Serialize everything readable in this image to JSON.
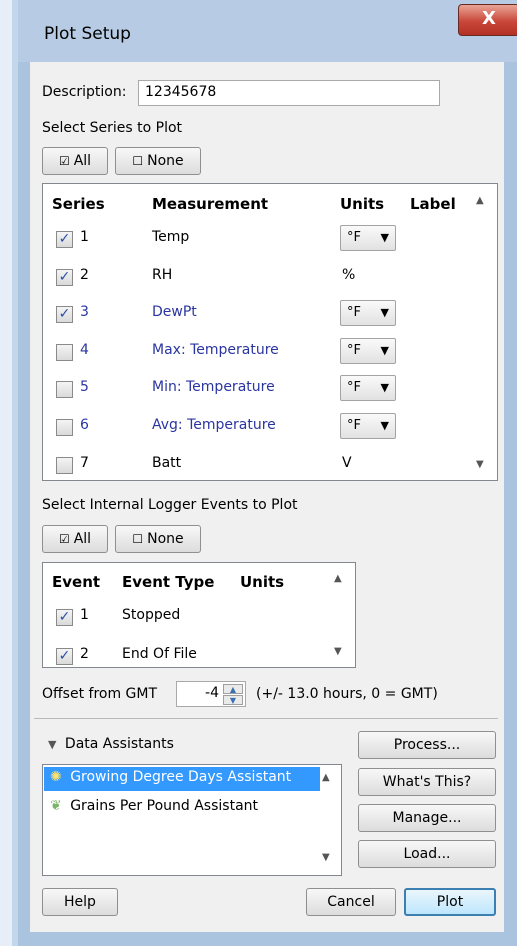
{
  "window": {
    "title": "Plot Setup",
    "close_label": "X"
  },
  "description": {
    "label": "Description:",
    "value": "12345678"
  },
  "series_section": {
    "title": "Select Series to Plot",
    "all_button": "All",
    "none_button": "None",
    "headers": {
      "series": "Series",
      "measurement": "Measurement",
      "units": "Units",
      "label": "Label"
    },
    "rows": [
      {
        "num": "1",
        "checked": true,
        "measurement": "Temp",
        "units": "°F",
        "units_type": "select",
        "link": false
      },
      {
        "num": "2",
        "checked": true,
        "measurement": "RH",
        "units": "%",
        "units_type": "text",
        "link": false
      },
      {
        "num": "3",
        "checked": true,
        "measurement": "DewPt",
        "units": "°F",
        "units_type": "select",
        "link": true
      },
      {
        "num": "4",
        "checked": false,
        "measurement": "Max: Temperature",
        "units": "°F",
        "units_type": "select",
        "link": true
      },
      {
        "num": "5",
        "checked": false,
        "measurement": "Min: Temperature",
        "units": "°F",
        "units_type": "select",
        "link": true
      },
      {
        "num": "6",
        "checked": false,
        "measurement": "Avg: Temperature",
        "units": "°F",
        "units_type": "select",
        "link": true
      },
      {
        "num": "7",
        "checked": false,
        "measurement": "Batt",
        "units": "V",
        "units_type": "text",
        "link": false
      }
    ]
  },
  "events_section": {
    "title": "Select Internal Logger Events to Plot",
    "all_button": "All",
    "none_button": "None",
    "headers": {
      "event": "Event",
      "event_type": "Event Type",
      "units": "Units"
    },
    "rows": [
      {
        "num": "1",
        "checked": true,
        "type": "Stopped"
      },
      {
        "num": "2",
        "checked": true,
        "type": "End Of File"
      }
    ]
  },
  "offset": {
    "label": "Offset from GMT",
    "value": "-4",
    "hint": "(+/- 13.0 hours, 0 = GMT)"
  },
  "assistants": {
    "title": "Data Assistants",
    "items": [
      {
        "label": "Growing Degree Days Assistant",
        "selected": true
      },
      {
        "label": "Grains Per Pound Assistant",
        "selected": false
      }
    ],
    "buttons": {
      "process": "Process...",
      "whats_this": "What's This?",
      "manage": "Manage...",
      "load": "Load..."
    }
  },
  "footer": {
    "help": "Help",
    "cancel": "Cancel",
    "plot": "Plot"
  },
  "colors": {
    "accent": "#3399ff",
    "link": "#2a35a0",
    "titlebar": "#b7cce4",
    "close": "#c9473a"
  }
}
